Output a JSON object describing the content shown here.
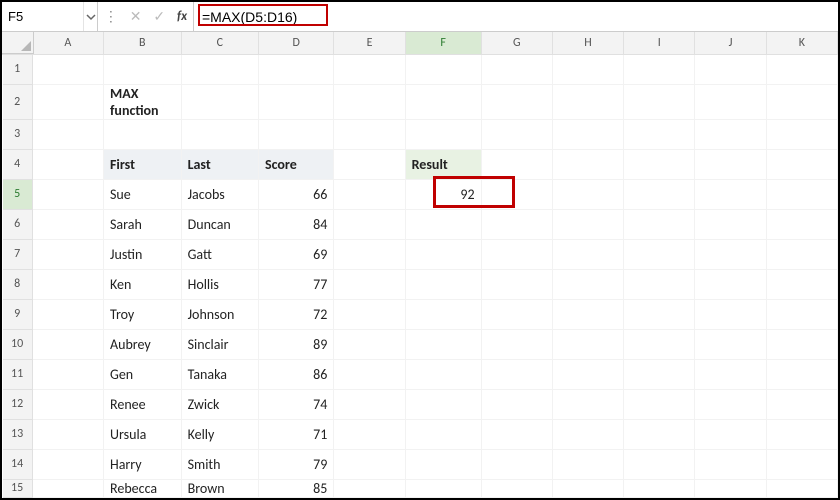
{
  "colors": {
    "highlight": "#c00000",
    "header_fill": "#eef1f4",
    "green_fill": "#e8f2e3"
  },
  "formula_bar": {
    "name_box": "F5",
    "formula": "=MAX(D5:D16)"
  },
  "columns": [
    "A",
    "B",
    "C",
    "D",
    "E",
    "F",
    "G",
    "H",
    "I",
    "J",
    "K"
  ],
  "rows": [
    "1",
    "2",
    "3",
    "4",
    "5",
    "6",
    "7",
    "8",
    "9",
    "10",
    "11",
    "12",
    "13",
    "14",
    "15"
  ],
  "title_cell": {
    "text": "MAX function"
  },
  "table": {
    "headers": {
      "first": "First",
      "last": "Last",
      "score": "Score"
    },
    "rows": [
      {
        "first": "Sue",
        "last": "Jacobs",
        "score": 66
      },
      {
        "first": "Sarah",
        "last": "Duncan",
        "score": 84
      },
      {
        "first": "Justin",
        "last": "Gatt",
        "score": 69
      },
      {
        "first": "Ken",
        "last": "Hollis",
        "score": 77
      },
      {
        "first": "Troy",
        "last": "Johnson",
        "score": 72
      },
      {
        "first": "Aubrey",
        "last": "Sinclair",
        "score": 89
      },
      {
        "first": "Gen",
        "last": "Tanaka",
        "score": 86
      },
      {
        "first": "Renee",
        "last": "Zwick",
        "score": 74
      },
      {
        "first": "Ursula",
        "last": "Kelly",
        "score": 71
      },
      {
        "first": "Harry",
        "last": "Smith",
        "score": 79
      },
      {
        "first": "Rebecca",
        "last": "Brown",
        "score": 85
      }
    ]
  },
  "result": {
    "label": "Result",
    "value": 92
  }
}
